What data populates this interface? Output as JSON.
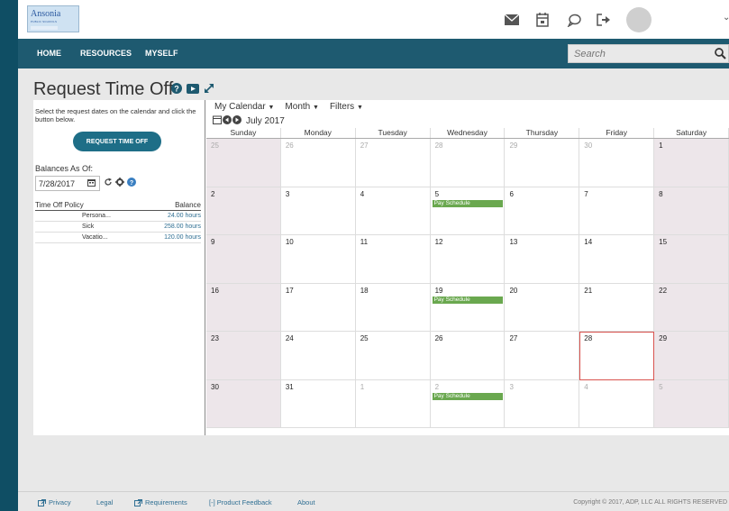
{
  "logo": {
    "name": "Ansonia",
    "subtitle": "PUBLIC SCHOOLS"
  },
  "nav": {
    "home": "HOME",
    "resources": "RESOURCES",
    "myself": "MYSELF"
  },
  "search": {
    "placeholder": "Search"
  },
  "page": {
    "title": "Request Time Off"
  },
  "left": {
    "instructions": "Select the request dates on the calendar and click the button below.",
    "request_button": "REQUEST TIME OFF",
    "balances_label": "Balances As Of:",
    "date": "7/28/2017",
    "policy_header": "Time Off Policy",
    "balance_header": "Balance",
    "policies": [
      {
        "name": "Persona...",
        "balance": "24.00 hours"
      },
      {
        "name": "Sick",
        "balance": "258.00 hours"
      },
      {
        "name": "Vacatio...",
        "balance": "120.00 hours"
      }
    ]
  },
  "calendar": {
    "view_menu": "My Calendar",
    "range_menu": "Month",
    "filters_menu": "Filters",
    "month_label": "July 2017",
    "days_of_week": [
      "Sunday",
      "Monday",
      "Tuesday",
      "Wednesday",
      "Thursday",
      "Friday",
      "Saturday"
    ],
    "weeks": [
      [
        {
          "d": "25",
          "o": true
        },
        {
          "d": "26",
          "o": true
        },
        {
          "d": "27",
          "o": true
        },
        {
          "d": "28",
          "o": true
        },
        {
          "d": "29",
          "o": true
        },
        {
          "d": "30",
          "o": true
        },
        {
          "d": "1"
        }
      ],
      [
        {
          "d": "2"
        },
        {
          "d": "3"
        },
        {
          "d": "4"
        },
        {
          "d": "5",
          "e": "Pay Schedule"
        },
        {
          "d": "6"
        },
        {
          "d": "7"
        },
        {
          "d": "8"
        }
      ],
      [
        {
          "d": "9"
        },
        {
          "d": "10"
        },
        {
          "d": "11"
        },
        {
          "d": "12"
        },
        {
          "d": "13"
        },
        {
          "d": "14"
        },
        {
          "d": "15"
        }
      ],
      [
        {
          "d": "16"
        },
        {
          "d": "17"
        },
        {
          "d": "18"
        },
        {
          "d": "19",
          "e": "Pay Schedule"
        },
        {
          "d": "20"
        },
        {
          "d": "21"
        },
        {
          "d": "22"
        }
      ],
      [
        {
          "d": "23"
        },
        {
          "d": "24"
        },
        {
          "d": "25"
        },
        {
          "d": "26"
        },
        {
          "d": "27"
        },
        {
          "d": "28",
          "t": true
        },
        {
          "d": "29"
        }
      ],
      [
        {
          "d": "30"
        },
        {
          "d": "31"
        },
        {
          "d": "1",
          "o": true
        },
        {
          "d": "2",
          "o": true,
          "e": "Pay Schedule"
        },
        {
          "d": "3",
          "o": true
        },
        {
          "d": "4",
          "o": true
        },
        {
          "d": "5",
          "o": true
        }
      ]
    ]
  },
  "footer": {
    "privacy": "Privacy",
    "legal": "Legal",
    "requirements": "Requirements",
    "feedback": "[-] Product Feedback",
    "about": "About",
    "copyright": "Copyright © 2017, ADP, LLC ALL RIGHTS RESERVED"
  },
  "colors": {
    "nav": "#1e5a70",
    "strip": "#0f4e64",
    "event": "#6aa84f",
    "today": "#d9534f",
    "link": "#2f6f93"
  }
}
